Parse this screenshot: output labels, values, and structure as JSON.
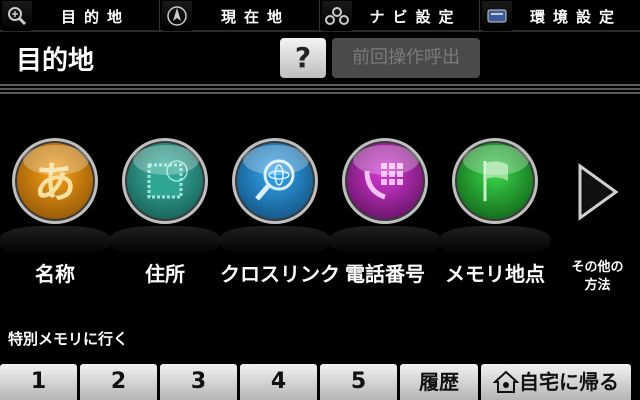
{
  "tabs": [
    {
      "icon": "search-icon",
      "label": "目的地"
    },
    {
      "icon": "compass-icon",
      "label": "現在地"
    },
    {
      "icon": "car-icon",
      "label": "ナビ設定"
    },
    {
      "icon": "screen-icon",
      "label": "環境設定"
    }
  ],
  "header": {
    "title": "目的地",
    "help_label": "?",
    "prev_label": "前回操作呼出"
  },
  "categories": [
    {
      "label": "名称",
      "icon": "hiragana-a-icon",
      "color": "#e08a00"
    },
    {
      "label": "住所",
      "icon": "postage-stamp-icon",
      "color": "#1d8a7c"
    },
    {
      "label": "クロスリンク",
      "icon": "magnifier-network-icon",
      "color": "#1f8fd6"
    },
    {
      "label": "電話番号",
      "icon": "phone-keypad-icon",
      "color": "#b21fb2"
    },
    {
      "label": "メモリ地点",
      "icon": "flag-icon",
      "color": "#1f9a2a"
    }
  ],
  "other": {
    "line1": "その他の",
    "line2": "方法"
  },
  "memory": {
    "label": "特別メモリに行く",
    "buttons": [
      "1",
      "2",
      "3",
      "4",
      "5"
    ],
    "history_label": "履歴",
    "home_label": "自宅に帰る"
  }
}
